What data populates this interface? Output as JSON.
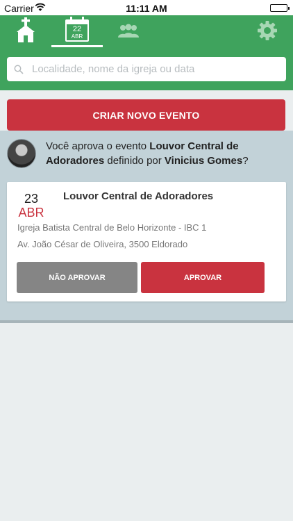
{
  "status_bar": {
    "carrier": "Carrier",
    "time": "11:11 AM"
  },
  "navbar": {
    "calendar_icon": {
      "day": "22",
      "month": "ABR"
    },
    "tabs": [
      "church-icon",
      "calendar-icon",
      "people-icon",
      "gear-icon"
    ],
    "color": "#3fa35d"
  },
  "search": {
    "placeholder": "Localidade, nome da igreja ou data"
  },
  "create_button": {
    "label": "CRIAR NOVO EVENTO",
    "color": "#c9333f"
  },
  "approval": {
    "prefix": "Você aprova o evento ",
    "event_name": "Louvor Central de Adoradores",
    "middle": " definido por ",
    "user_name": "Vinicius Gomes",
    "suffix": "?"
  },
  "event": {
    "day": "23",
    "month": "ABR",
    "title": "Louvor Central de Adoradores",
    "church": "Igreja Batista Central de Belo Horizonte - IBC 1",
    "address": "Av. João César de Oliveira, 3500 Eldorado",
    "reject_label": "NÃO APROVAR",
    "approve_label": "APROVAR"
  }
}
